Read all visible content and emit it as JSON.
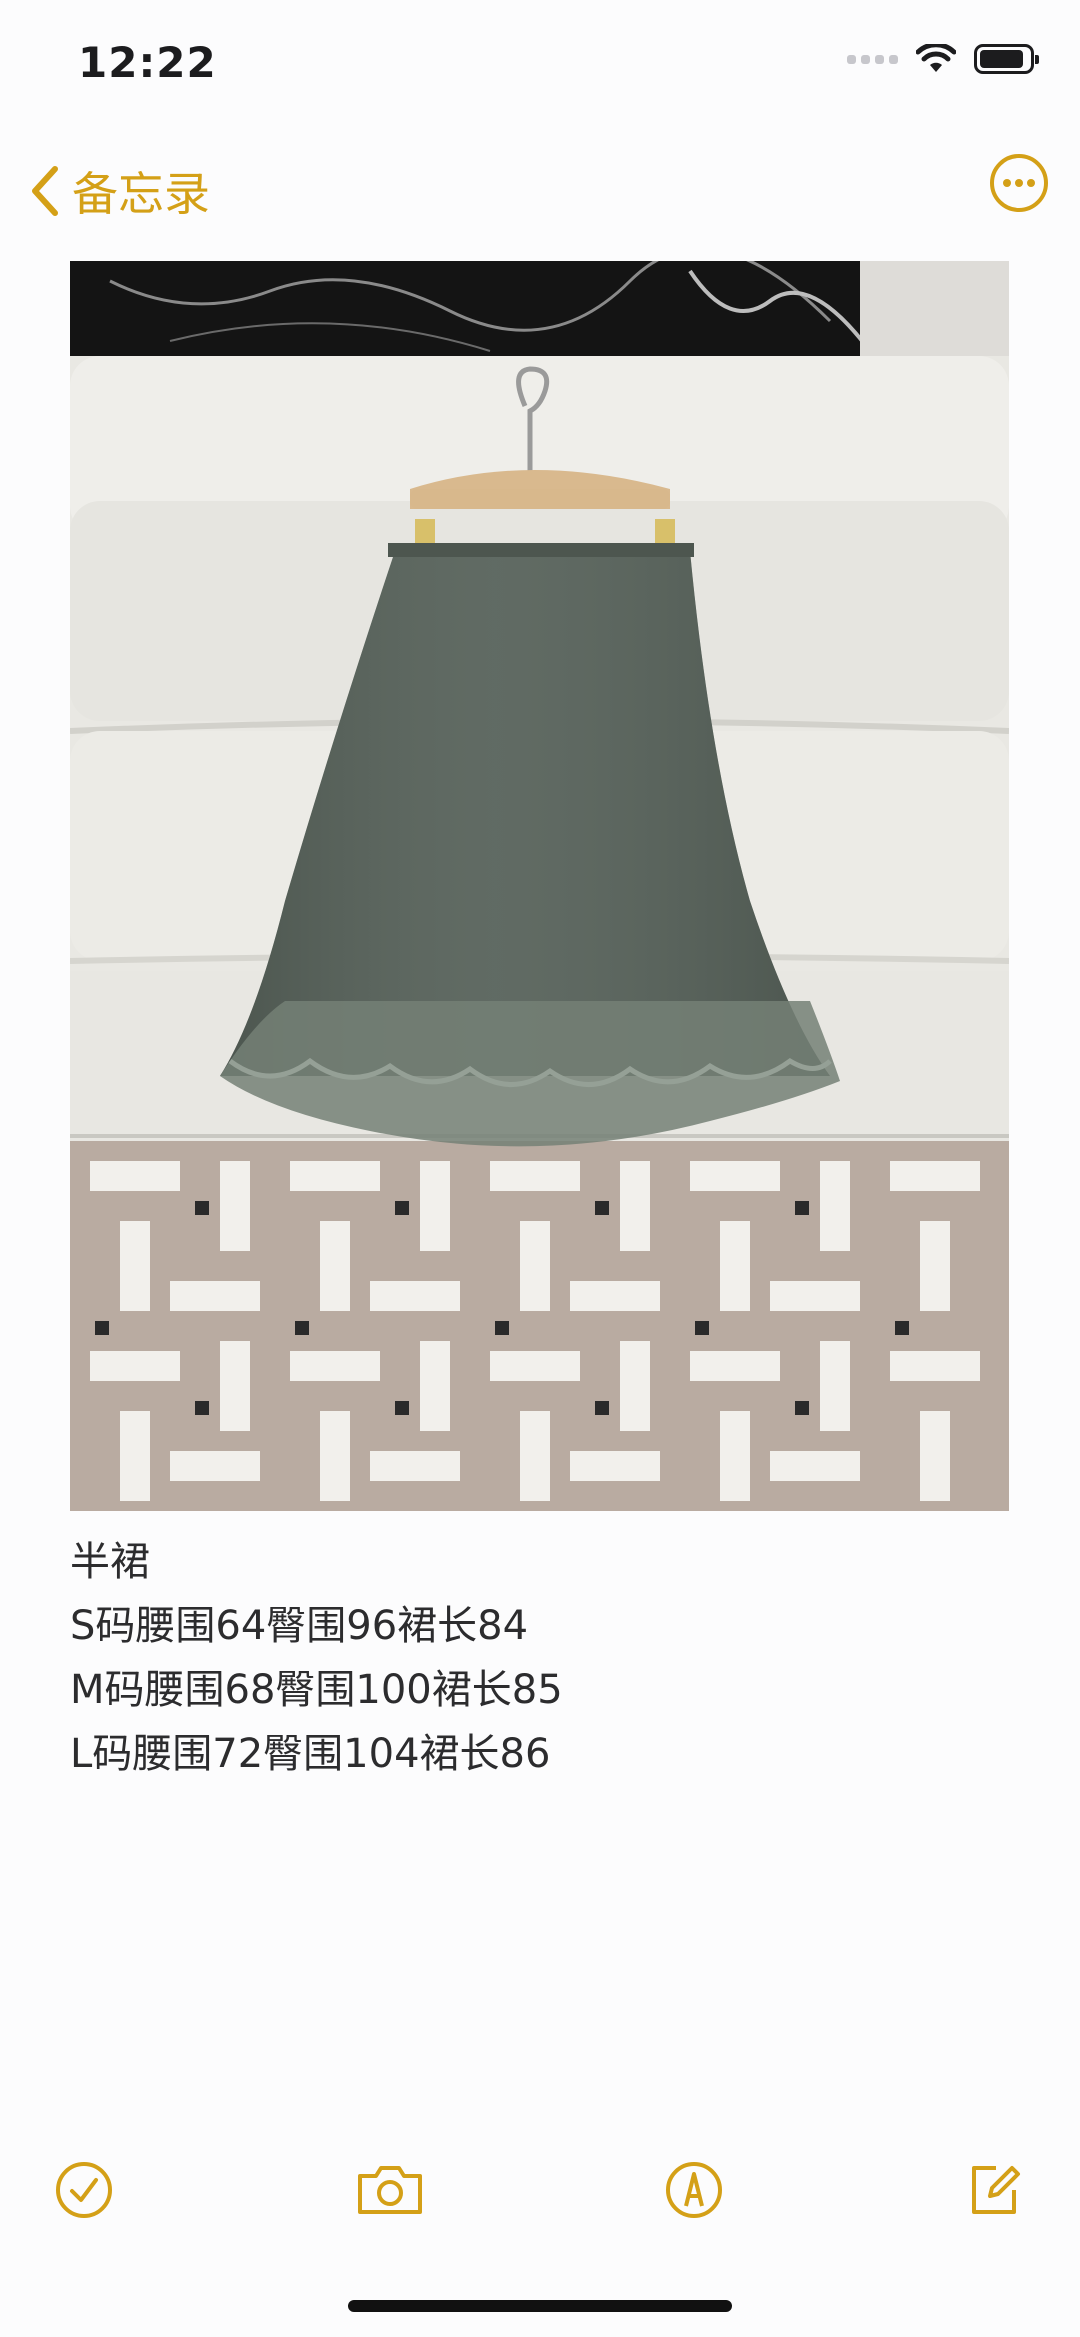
{
  "status_bar": {
    "time": "12:22"
  },
  "nav": {
    "back_label": "备忘录",
    "back_icon": "chevron-left-icon",
    "more_icon": "ellipsis-circle-icon"
  },
  "accent_color": "#d4a017",
  "note": {
    "image": "photo of a green satin midi skirt with lace hem hanging on a wooden hanger",
    "lines": [
      "半裙",
      "S码腰围64臀围96裙长84",
      "M码腰围68臀围100裙长85",
      "L码腰围72臀围104裙长86"
    ]
  },
  "toolbar": {
    "items": [
      {
        "icon": "checklist-icon"
      },
      {
        "icon": "camera-icon"
      },
      {
        "icon": "markup-pen-icon"
      },
      {
        "icon": "compose-icon"
      }
    ]
  }
}
